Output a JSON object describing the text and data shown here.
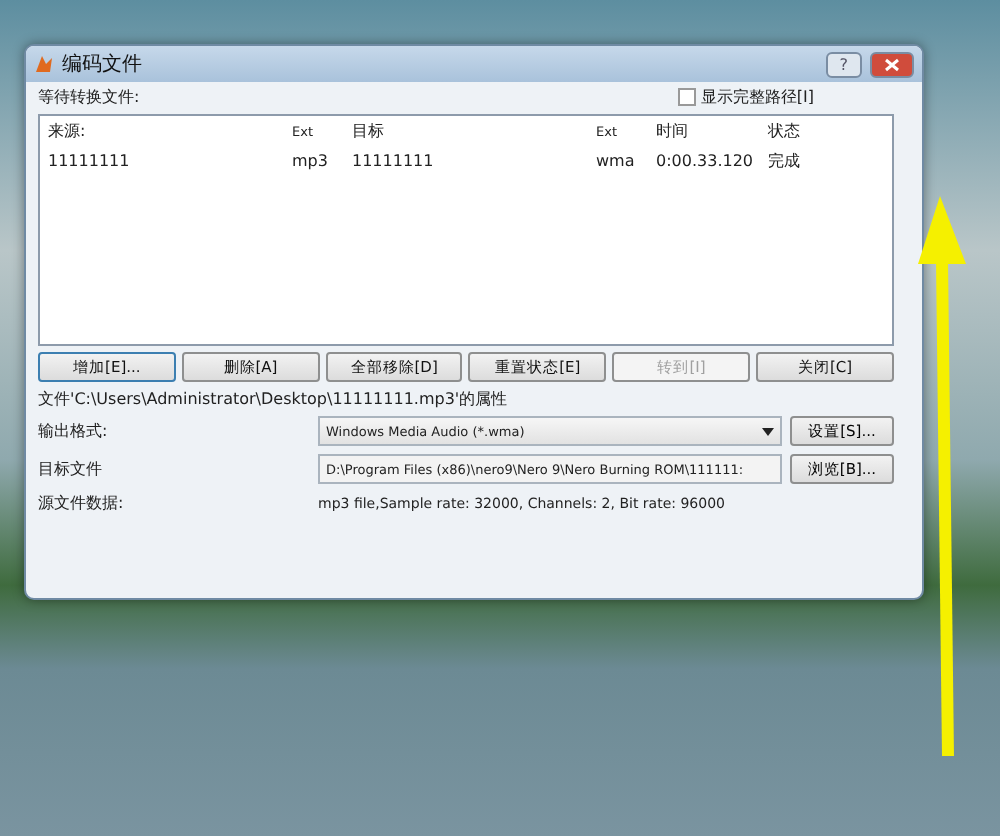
{
  "window": {
    "title": "编码文件",
    "help": "?"
  },
  "queue": {
    "label": "等待转换文件:",
    "show_full_path": {
      "label": "显示完整路径[I]",
      "checked": false
    }
  },
  "table": {
    "columns": [
      "来源:",
      "Ext",
      "目标",
      "Ext",
      "时间",
      "状态"
    ],
    "rows": [
      {
        "cells": [
          "11111111",
          "mp3",
          "11111111",
          "wma",
          "0:00.33.120",
          "完成"
        ],
        "selected": false
      }
    ]
  },
  "buttons": [
    {
      "label": "增加[E]...",
      "disabled": false,
      "focused": true
    },
    {
      "label": "删除[A]",
      "disabled": false,
      "focused": false
    },
    {
      "label": "全部移除[D]",
      "disabled": false,
      "focused": false
    },
    {
      "label": "重置状态[E]",
      "disabled": false,
      "focused": false
    },
    {
      "label": "转到[I]",
      "disabled": true,
      "focused": false
    },
    {
      "label": "关闭[C]",
      "disabled": false,
      "focused": false
    }
  ],
  "properties": {
    "title": "文件'C:\\Users\\Administrator\\Desktop\\11111111.mp3'的属性",
    "rows": [
      {
        "kind": "select",
        "label": "输出格式:",
        "value": "Windows Media Audio (*.wma)",
        "button": "设置[S]..."
      },
      {
        "kind": "path",
        "label": "目标文件",
        "value": "D:\\Program Files (x86)\\nero9\\Nero 9\\Nero Burning ROM\\111111:",
        "button": "浏览[B]..."
      },
      {
        "kind": "info",
        "label": "源文件数据:",
        "value": "mp3 file,Sample rate: 32000, Channels: 2, Bit rate: 96000"
      }
    ]
  }
}
